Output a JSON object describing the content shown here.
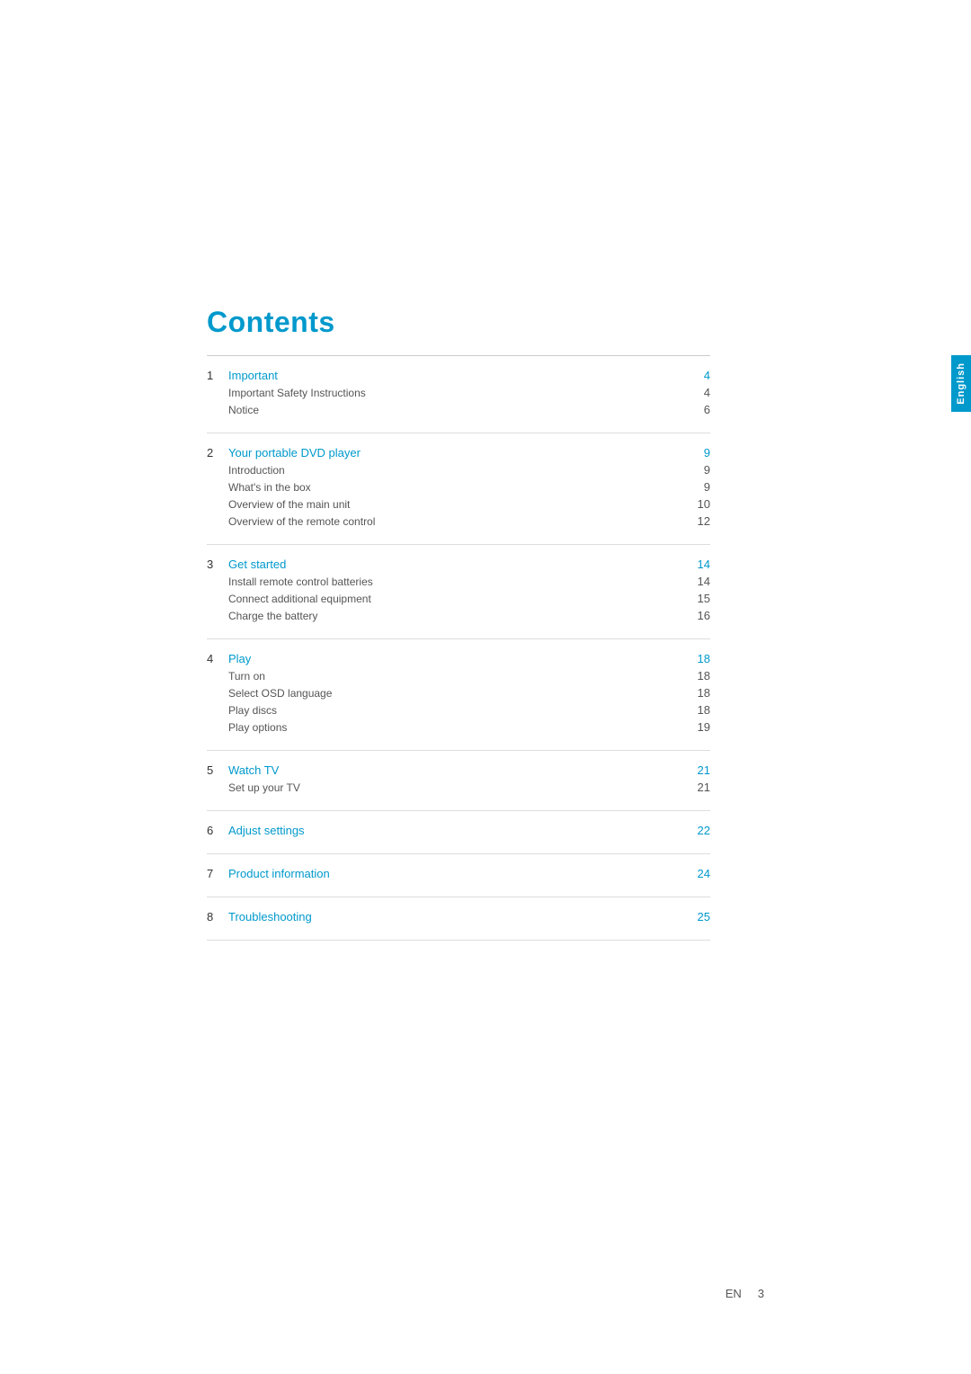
{
  "page": {
    "title": "Contents",
    "footer": {
      "lang": "EN",
      "page_number": "3"
    },
    "sidebar": {
      "label": "English"
    }
  },
  "toc": {
    "sections": [
      {
        "number": "1",
        "title": "Important",
        "page": "4",
        "items": [
          {
            "label": "Important Safety Instructions",
            "page": "4"
          },
          {
            "label": "Notice",
            "page": "6"
          }
        ]
      },
      {
        "number": "2",
        "title": "Your portable DVD player",
        "page": "9",
        "items": [
          {
            "label": "Introduction",
            "page": "9"
          },
          {
            "label": "What's in the box",
            "page": "9"
          },
          {
            "label": "Overview of the main unit",
            "page": "10"
          },
          {
            "label": "Overview of the remote control",
            "page": "12"
          }
        ]
      },
      {
        "number": "3",
        "title": "Get started",
        "page": "14",
        "items": [
          {
            "label": "Install remote control batteries",
            "page": "14"
          },
          {
            "label": "Connect additional equipment",
            "page": "15"
          },
          {
            "label": "Charge the battery",
            "page": "16"
          }
        ]
      },
      {
        "number": "4",
        "title": "Play",
        "page": "18",
        "items": [
          {
            "label": "Turn on",
            "page": "18"
          },
          {
            "label": "Select OSD language",
            "page": "18"
          },
          {
            "label": "Play discs",
            "page": "18"
          },
          {
            "label": "Play options",
            "page": "19"
          }
        ]
      },
      {
        "number": "5",
        "title": "Watch TV",
        "page": "21",
        "items": [
          {
            "label": "Set up your TV",
            "page": "21"
          }
        ]
      },
      {
        "number": "6",
        "title": "Adjust settings",
        "page": "22",
        "items": []
      },
      {
        "number": "7",
        "title": "Product information",
        "page": "24",
        "items": []
      },
      {
        "number": "8",
        "title": "Troubleshooting",
        "page": "25",
        "items": []
      }
    ]
  }
}
